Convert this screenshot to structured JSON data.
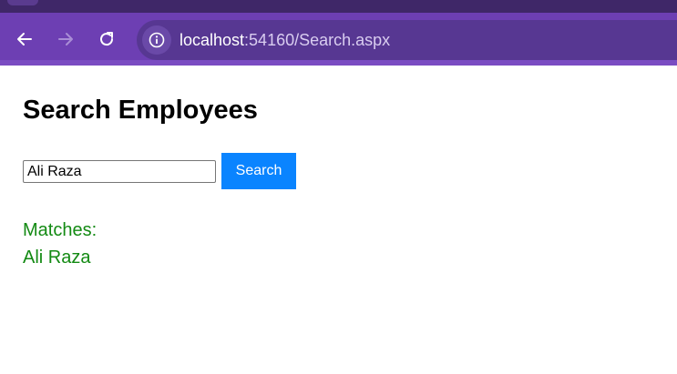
{
  "browser": {
    "url_host": "localhost",
    "url_rest": ":54160/Search.aspx",
    "icons": {
      "back": "arrow-left-icon",
      "forward": "arrow-right-icon",
      "reload": "reload-icon",
      "site_info": "info-icon"
    },
    "colors": {
      "frame": "#6d3fb3",
      "omnibox": "#573792",
      "tabstrip": "#3f2768"
    }
  },
  "page": {
    "title": "Search Employees",
    "search": {
      "value": "Ali Raza",
      "button_label": "Search"
    },
    "results": {
      "label": "Matches:",
      "items": [
        "Ali Raza"
      ]
    },
    "colors": {
      "button": "#0a84ff",
      "results_text": "#138a13"
    }
  }
}
